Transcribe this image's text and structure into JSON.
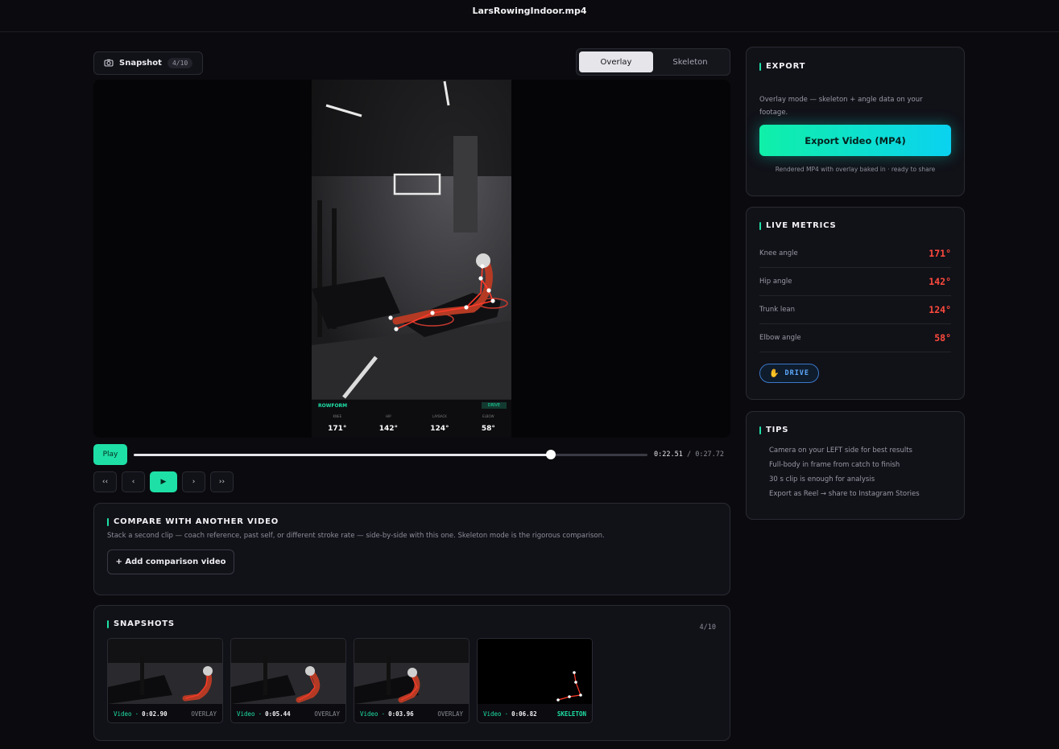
{
  "header": {
    "title": "LarsRowingIndoor.mp4"
  },
  "toolbar": {
    "snapshot_label": "Snapshot",
    "snapshot_count": "4/10",
    "view_modes": [
      "Overlay",
      "Skeleton"
    ],
    "active_mode": "Overlay"
  },
  "video_hud": {
    "brand": "ROWFORM",
    "phase": "DRIVE",
    "metrics": [
      {
        "key": "KNEE",
        "value": "171°"
      },
      {
        "key": "HIP",
        "value": "142°"
      },
      {
        "key": "LAYBACK",
        "value": "124°"
      },
      {
        "key": "ELBOW",
        "value": "58°"
      }
    ]
  },
  "player": {
    "play_label": "Play",
    "current_time": "0:22.51",
    "separator": "/",
    "total_time": "0:27.72",
    "progress": 0.812,
    "steps": [
      "‹‹",
      "‹",
      "▶",
      "›",
      "››"
    ]
  },
  "compare": {
    "title": "COMPARE WITH ANOTHER VIDEO",
    "description": "Stack a second clip — coach reference, past self, or different stroke rate — side-by-side with this one. Skeleton mode is the rigorous comparison.",
    "button_label": "+ Add comparison video"
  },
  "snapshots": {
    "title": "SNAPSHOTS",
    "count": "4/10",
    "items": [
      {
        "source": "Video",
        "time": "0:02.90",
        "mode": "OVERLAY"
      },
      {
        "source": "Video",
        "time": "0:05.44",
        "mode": "OVERLAY"
      },
      {
        "source": "Video",
        "time": "0:03.96",
        "mode": "OVERLAY"
      },
      {
        "source": "Video",
        "time": "0:06.82",
        "mode": "SKELETON"
      }
    ]
  },
  "export": {
    "title": "EXPORT",
    "description": "Overlay mode — skeleton + angle data on your footage.",
    "button_label": "Export Video (MP4)",
    "note": "Rendered MP4 with overlay baked in · ready to share"
  },
  "live_metrics": {
    "title": "LIVE METRICS",
    "rows": [
      {
        "label": "Knee angle",
        "value": "171°"
      },
      {
        "label": "Hip angle",
        "value": "142°"
      },
      {
        "label": "Trunk lean",
        "value": "124°"
      },
      {
        "label": "Elbow angle",
        "value": "58°"
      }
    ],
    "phase_label": "DRIVE",
    "phase_icon": "flexed-arm-icon"
  },
  "tips": {
    "title": "TIPS",
    "items": [
      "Camera on your LEFT side for best results",
      "Full-body in frame from catch to finish",
      "30 s clip is enough for analysis",
      "Export as Reel → share to Instagram Stories"
    ]
  },
  "colors": {
    "accent": "#1ee0a6",
    "metric_value": "#ff4a3d",
    "phase_badge": "#5ea9ff",
    "background": "#0b0b0f"
  }
}
